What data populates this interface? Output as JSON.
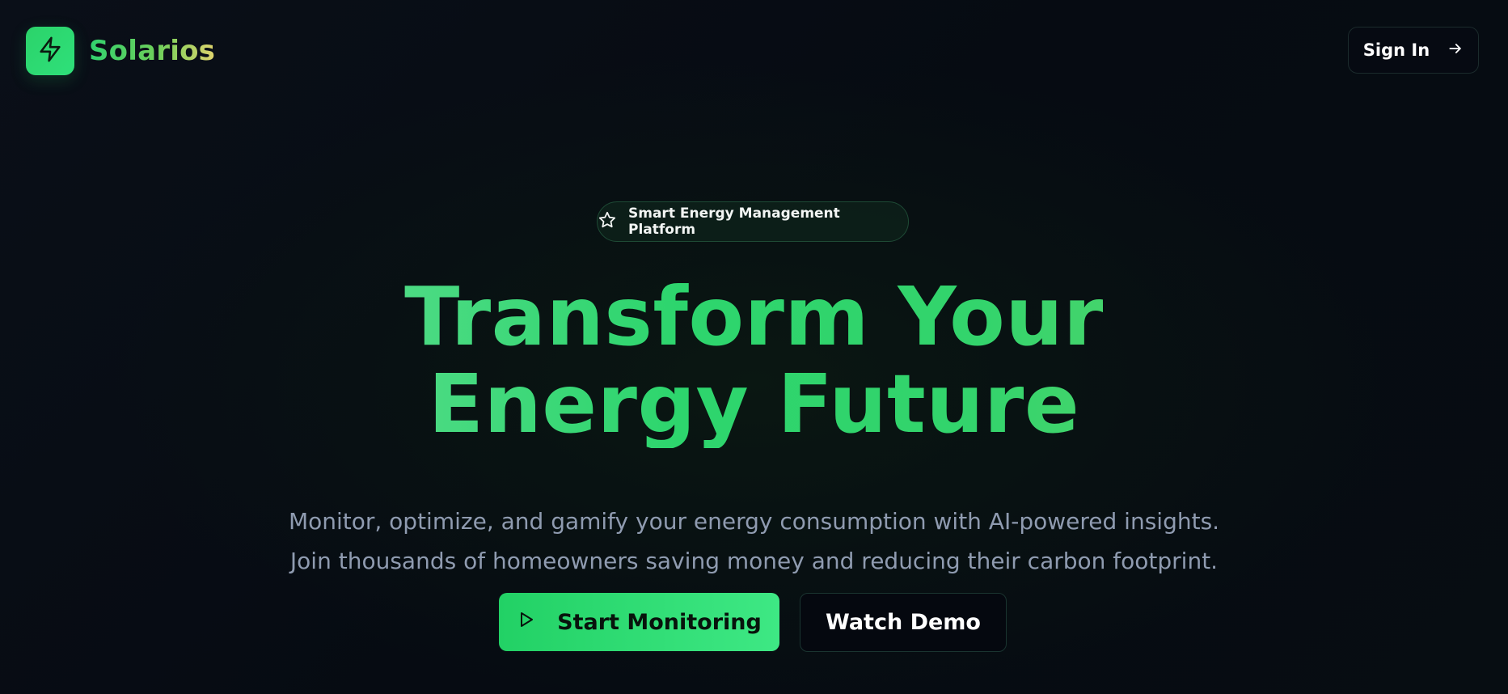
{
  "brand": {
    "name": "Solarios",
    "logo_icon": "lightning-bolt-icon",
    "accent": "#2bd36a"
  },
  "header": {
    "sign_in_label": "Sign In",
    "sign_in_icon": "arrow-right-icon"
  },
  "hero": {
    "badge_icon": "star-icon",
    "badge_label": "Smart Energy Management Platform",
    "headline_line1": "Transform Your",
    "headline_line2": "Energy Future",
    "subtext_line1": "Monitor, optimize, and gamify your energy consumption with AI-powered insights.",
    "subtext_line2": "Join thousands of homeowners saving money and reducing their carbon footprint.",
    "primary_cta_label": "Start Monitoring",
    "primary_cta_icon": "play-icon",
    "secondary_cta_label": "Watch Demo"
  },
  "colors": {
    "background": "#060b12",
    "primary_green": "#22d165",
    "muted_text": "#8f9bb0"
  }
}
